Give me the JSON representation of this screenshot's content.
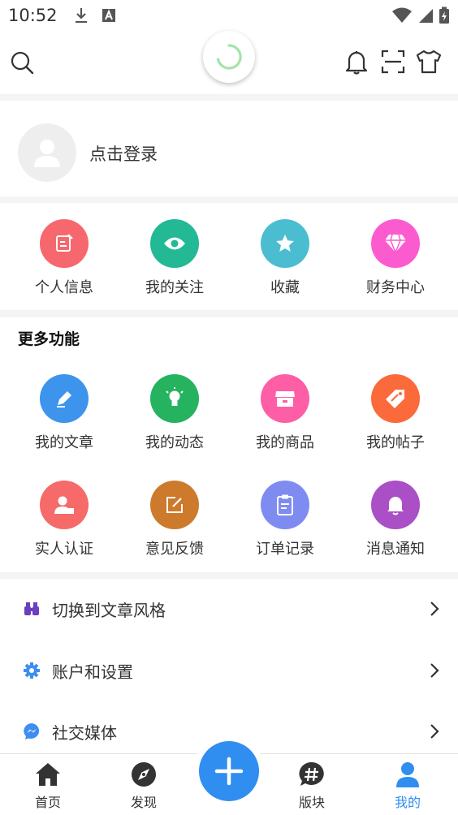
{
  "status_bar": {
    "time": "10:52"
  },
  "login": {
    "label": "点击登录"
  },
  "quick": {
    "items": [
      {
        "label": "个人信息",
        "icon": "edit-note-icon",
        "color": "#f6686e"
      },
      {
        "label": "我的关注",
        "icon": "eye-icon",
        "color": "#22b994"
      },
      {
        "label": "收藏",
        "icon": "star-icon",
        "color": "#4bbdd0"
      },
      {
        "label": "财务中心",
        "icon": "diamond-icon",
        "color": "#fc5bd0"
      }
    ]
  },
  "more": {
    "title": "更多功能",
    "items": [
      {
        "label": "我的文章",
        "icon": "pencil-icon",
        "color": "#3c94ec"
      },
      {
        "label": "我的动态",
        "icon": "lightbulb-icon",
        "color": "#25b35f"
      },
      {
        "label": "我的商品",
        "icon": "store-icon",
        "color": "#fd5ea6"
      },
      {
        "label": "我的帖子",
        "icon": "tag-icon",
        "color": "#fb6a3a"
      },
      {
        "label": "实人认证",
        "icon": "id-person-icon",
        "color": "#f66a6a"
      },
      {
        "label": "意见反馈",
        "icon": "feedback-edit-icon",
        "color": "#cd7a2c"
      },
      {
        "label": "订单记录",
        "icon": "clipboard-icon",
        "color": "#7e8cf2"
      },
      {
        "label": "消息通知",
        "icon": "bell-icon",
        "color": "#ab4fc6"
      }
    ]
  },
  "list": {
    "items": [
      {
        "label": "切换到文章风格",
        "icon": "binoculars-icon",
        "color": "#6a3fc0"
      },
      {
        "label": "账户和设置",
        "icon": "gear-icon",
        "color": "#3d8ef0"
      },
      {
        "label": "社交媒体",
        "icon": "messenger-icon",
        "color": "#3d8ef0"
      }
    ]
  },
  "nav": {
    "items": [
      {
        "label": "首页",
        "icon": "home-icon"
      },
      {
        "label": "发现",
        "icon": "compass-icon"
      },
      {
        "label": "版块",
        "icon": "hashtag-icon"
      },
      {
        "label": "我的",
        "icon": "person-icon",
        "active": true
      }
    ],
    "accent": "#2f8ef0"
  }
}
